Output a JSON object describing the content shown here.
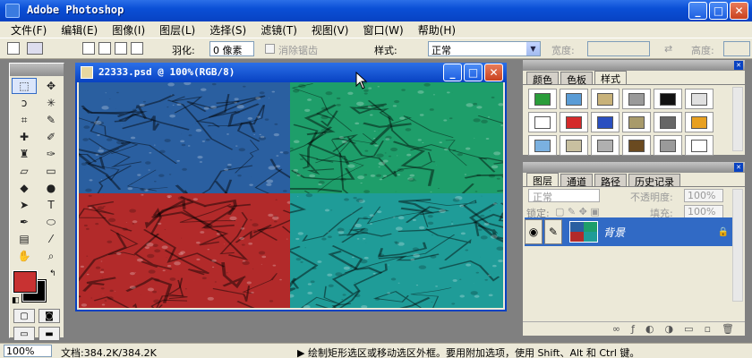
{
  "window": {
    "title": "Adobe Photoshop",
    "min": "_",
    "max": "□",
    "close": "✕"
  },
  "menu": [
    "文件(F)",
    "编辑(E)",
    "图像(I)",
    "图层(L)",
    "选择(S)",
    "滤镜(T)",
    "视图(V)",
    "窗口(W)",
    "帮助(H)"
  ],
  "options": {
    "feather_label": "羽化:",
    "feather_value": "0 像素",
    "antialias_label": "消除锯齿",
    "style_label": "样式:",
    "style_value": "正常",
    "width_label": "宽度:",
    "height_label": "高度:"
  },
  "document": {
    "title": "22333.psd @ 100%(RGB/8)",
    "quadrant_colors": [
      "#2a5fa0",
      "#1e9e6a",
      "#b22a2a",
      "#1f9c98"
    ]
  },
  "styles_panel": {
    "tabs": [
      "颜色",
      "色板",
      "样式"
    ],
    "active_tab": 2,
    "swatches": [
      "#2a9d3a",
      "#5a9cd6",
      "#c8b27a",
      "#9a9a9a",
      "#111111",
      "#e0e0e0",
      "#ffffff",
      "#d42a2a",
      "#2a4fc0",
      "#a89a6a",
      "#666666",
      "#e8a020",
      "#7ab0e0",
      "#c8c0a0",
      "#b0b0b0",
      "#6a4a20",
      "#9a9a9a",
      "#ffffff"
    ]
  },
  "layers_panel": {
    "tabs": [
      "图层",
      "通道",
      "路径",
      "历史记录"
    ],
    "active_tab": 0,
    "blend_mode": "正常",
    "opacity_label": "不透明度:",
    "opacity_value": "100%",
    "lock_label": "锁定:",
    "fill_label": "填充:",
    "fill_value": "100%",
    "layer_name": "背景"
  },
  "colors": {
    "foreground": "#c83232",
    "background": "#000000",
    "accent": "#316ac5"
  },
  "status": {
    "zoom": "100%",
    "doc_size": "文档:384.2K/384.2K",
    "message": "▶ 绘制矩形选区或移动选区外框。要用附加选项，使用 Shift、Alt 和 Ctrl 键。"
  }
}
